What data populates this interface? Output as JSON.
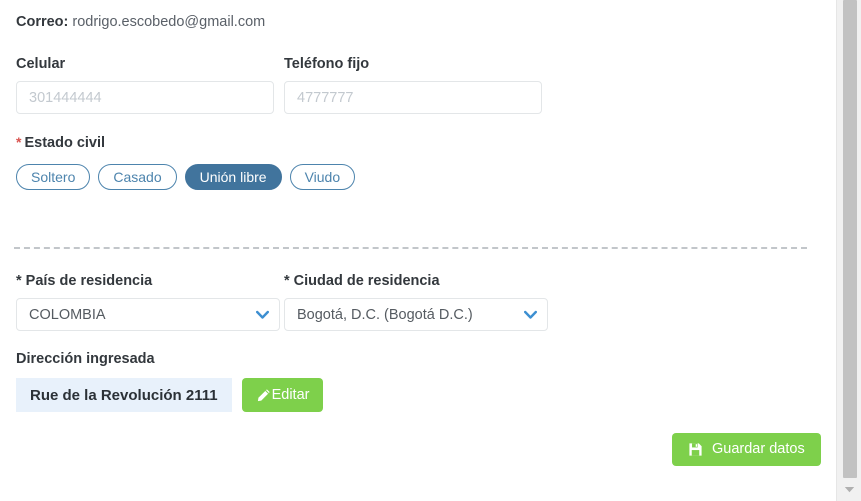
{
  "email_row": {
    "label": "Correo:",
    "value": "rodrigo.escobedo@gmail.com"
  },
  "phones": {
    "mobile": {
      "label": "Celular",
      "value": "",
      "placeholder": "301444444"
    },
    "landline": {
      "label": "Teléfono fijo",
      "value": "",
      "placeholder": "4777777"
    }
  },
  "marital_status": {
    "required_marker": "*",
    "label": "Estado civil",
    "options": [
      {
        "label": "Soltero",
        "selected": false
      },
      {
        "label": "Casado",
        "selected": false
      },
      {
        "label": "Unión libre",
        "selected": true
      },
      {
        "label": "Viudo",
        "selected": false
      }
    ],
    "selected_value": "Unión libre"
  },
  "residence": {
    "country": {
      "label": "* País de residencia",
      "value": "COLOMBIA"
    },
    "city": {
      "label": "* Ciudad de residencia",
      "value": "Bogotá, D.C. (Bogotá D.C.)"
    }
  },
  "address": {
    "label": "Dirección ingresada",
    "value": "Rue de la Revolución 2111",
    "edit_button": "Editar"
  },
  "actions": {
    "save_button": "Guardar datos"
  },
  "colors": {
    "pill_border": "#4d84ad",
    "pill_selected_bg": "#41749d",
    "green_button": "#7ed04b",
    "chip_bg": "#e8f1fb",
    "chevron_blue": "#3d8fd1",
    "required_red": "#d9534f",
    "divider": "#c2c6ca"
  },
  "icons": {
    "pencil": "pencil-icon",
    "save": "floppy-disk-icon",
    "chevron": "chevron-down-icon",
    "scroll_arrow": "scroll-down-arrow-icon"
  }
}
